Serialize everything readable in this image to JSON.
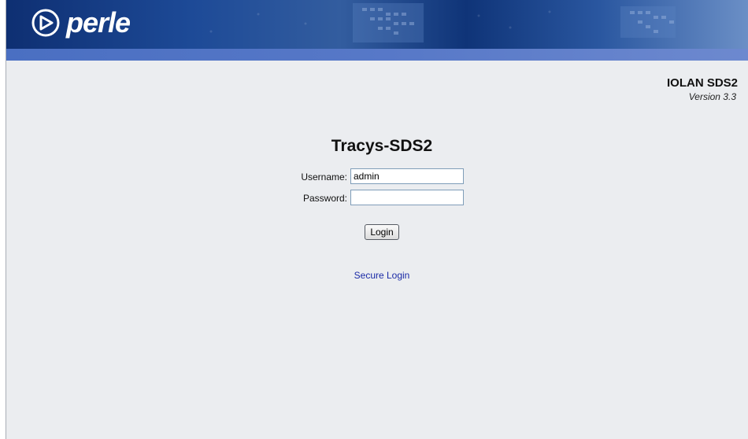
{
  "header": {
    "logo_text": "perle",
    "logo_icon": "perle-globe-logo-icon"
  },
  "product": {
    "name": "IOLAN SDS2",
    "version": "Version 3.3"
  },
  "login": {
    "device_name": "Tracys-SDS2",
    "username_label": "Username:",
    "username_value": "admin",
    "password_label": "Password:",
    "password_value": "",
    "login_button_label": "Login",
    "secure_login_link": "Secure Login"
  },
  "colors": {
    "header_dark": "#0e2f72",
    "header_band": "#4a6fc2",
    "background": "#ebedf0",
    "link": "#1a2aa6"
  }
}
